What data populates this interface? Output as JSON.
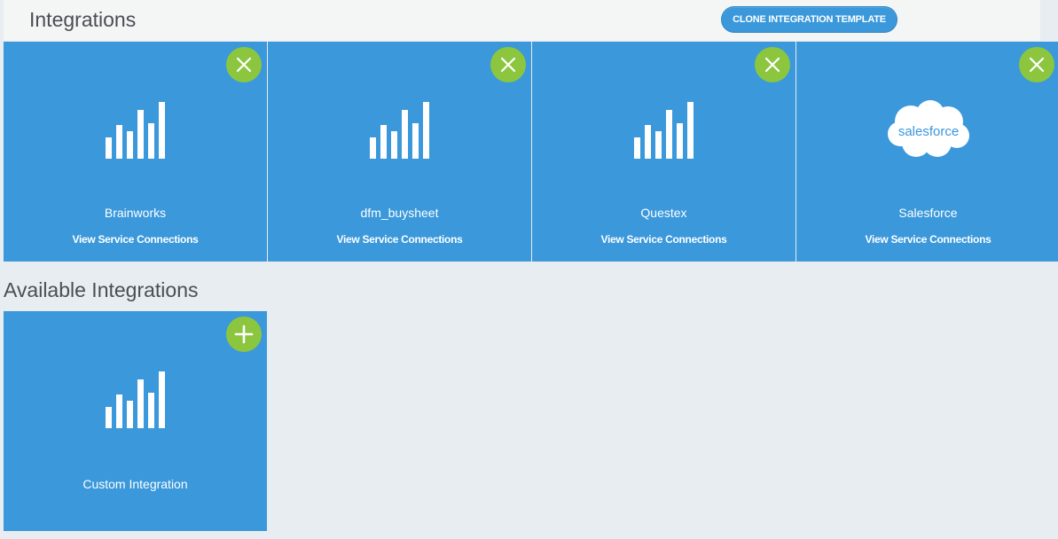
{
  "header": {
    "title": "Integrations",
    "clone_button": "CLONE INTEGRATION TEMPLATE"
  },
  "integrations": [
    {
      "name": "Brainworks",
      "link": "View Service Connections",
      "icon": "bar-chart-icon"
    },
    {
      "name": "dfm_buysheet",
      "link": "View Service Connections",
      "icon": "bar-chart-icon"
    },
    {
      "name": "Questex",
      "link": "View Service Connections",
      "icon": "bar-chart-icon"
    },
    {
      "name": "Salesforce",
      "link": "View Service Connections",
      "icon": "salesforce-logo",
      "logo_text": "salesforce"
    }
  ],
  "available_section": {
    "title": "Available Integrations",
    "items": [
      {
        "name": "Custom Integration",
        "icon": "bar-chart-icon"
      }
    ]
  },
  "colors": {
    "tile": "#3a98db",
    "action": "#8cc63f",
    "background": "#e8edf1"
  }
}
